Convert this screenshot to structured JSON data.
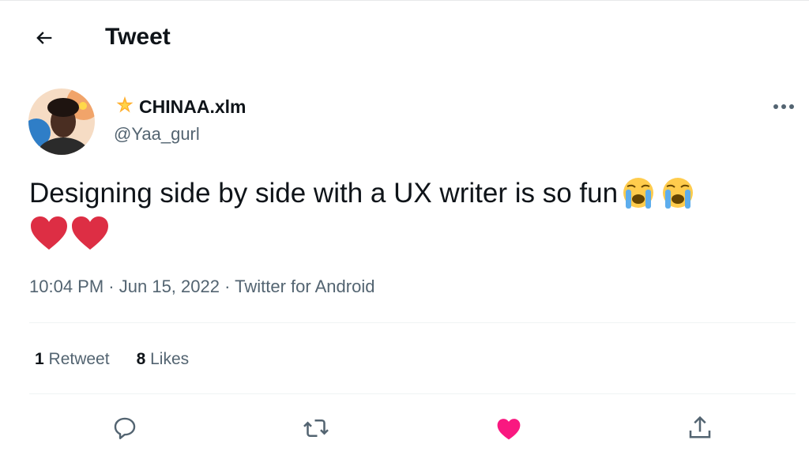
{
  "header": {
    "title": "Tweet"
  },
  "author": {
    "display_name": "CHINAA.xlm",
    "handle": "@Yaa_gurl"
  },
  "tweet": {
    "text": "Designing side by side with a UX writer is so fun",
    "emoji_after_text": [
      "loudly-crying-face",
      "loudly-crying-face"
    ],
    "emoji_line": [
      "red-heart",
      "red-heart"
    ]
  },
  "meta": {
    "time": "10:04 PM",
    "date": "Jun 15, 2022",
    "source": "Twitter for Android",
    "separator": "·"
  },
  "stats": {
    "retweets_count": "1",
    "retweets_label": "Retweet",
    "likes_count": "8",
    "likes_label": "Likes"
  },
  "actions": [
    "reply-icon",
    "retweet-icon",
    "like-icon",
    "share-icon"
  ],
  "colors": {
    "text": "#0f1419",
    "secondary": "#536471",
    "divider": "#eff3f4",
    "like_active": "#f91880",
    "heart_emoji": "#dd2e44"
  }
}
